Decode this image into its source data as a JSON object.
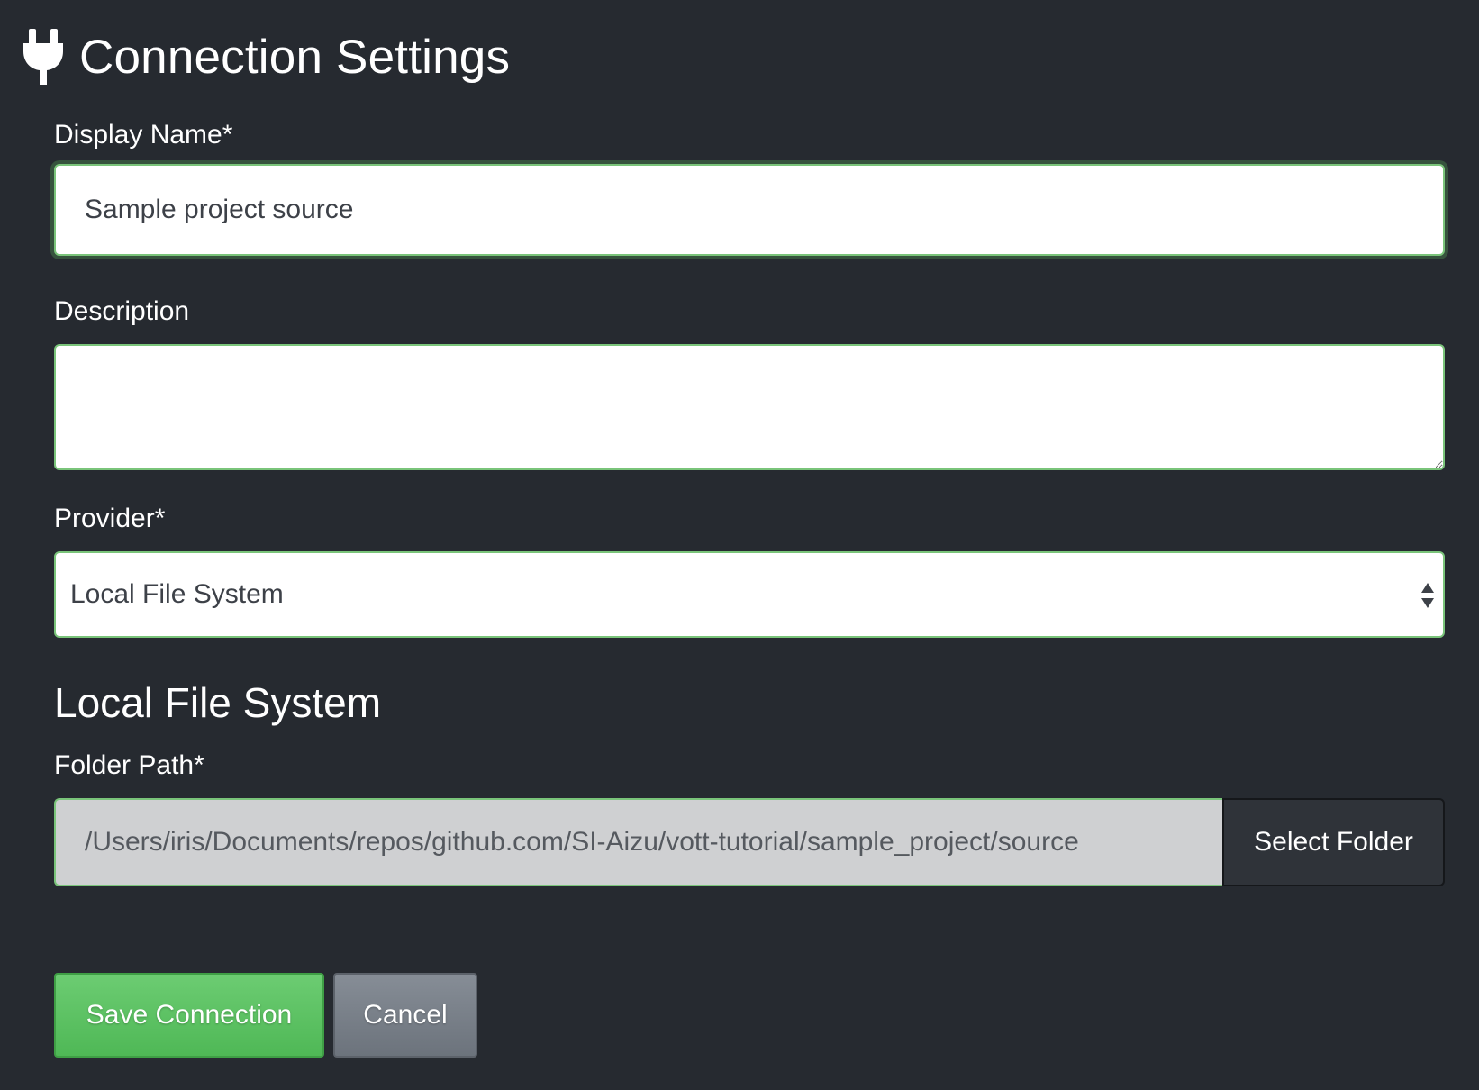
{
  "header": {
    "icon": "plug-icon",
    "title": "Connection Settings"
  },
  "form": {
    "display_name": {
      "label": "Display Name*",
      "value": "Sample project source"
    },
    "description": {
      "label": "Description",
      "value": ""
    },
    "provider": {
      "label": "Provider*",
      "selected": "Local File System",
      "icon": "select-arrows-icon"
    },
    "provider_section": {
      "title": "Local File System",
      "folder_path": {
        "label": "Folder Path*",
        "value": "/Users/iris/Documents/repos/github.com/SI-Aizu/vott-tutorial/sample_project/source",
        "button_label": "Select Folder"
      }
    }
  },
  "actions": {
    "save_label": "Save Connection",
    "cancel_label": "Cancel"
  },
  "colors": {
    "background": "#262a30",
    "focus_border": "#7ac47a",
    "save_button": "#5cc163",
    "cancel_button": "#7a818a",
    "select_folder_button": "#2f3339"
  }
}
